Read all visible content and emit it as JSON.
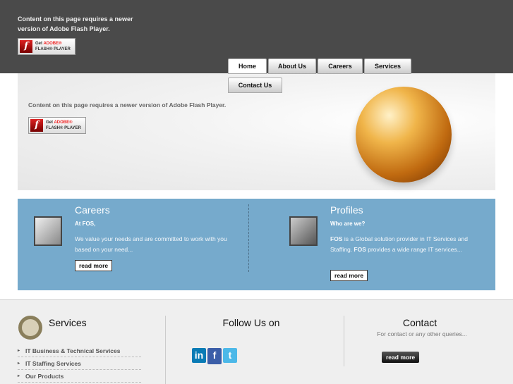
{
  "flash_notice": {
    "top_text": "Content on this page requires a newer version of Adobe Flash Player.",
    "hero_text": "Content on this page requires a newer version of Adobe Flash Player.",
    "button": {
      "get": "Get",
      "adobe": "ADOBE®",
      "player": "FLASH® PLAYER"
    }
  },
  "nav": {
    "items": [
      {
        "label": "Home"
      },
      {
        "label": "About Us"
      },
      {
        "label": "Careers"
      },
      {
        "label": "Services"
      },
      {
        "label": "Contact Us"
      }
    ]
  },
  "panel": {
    "careers": {
      "title": "Careers",
      "subtitle": "At FOS,",
      "text": "We value your needs and are committed to work with you based on your need...",
      "button": "read more"
    },
    "profiles": {
      "title": "Profiles",
      "subtitle": "Who are we?",
      "text_bold1": "FOS",
      "text1": " is a Global solution provider in IT Services and Staffing. ",
      "text_bold2": "FOS",
      "text2": " provides a wide range IT services...",
      "button": "read more"
    }
  },
  "footer": {
    "services": {
      "title": "Services",
      "items": [
        "IT Business & Technical Services",
        "IT Staffing Services",
        "Our Products"
      ]
    },
    "follow": {
      "title": "Follow Us on",
      "icons": [
        "linkedin-icon",
        "facebook-icon",
        "twitter-icon"
      ]
    },
    "contact": {
      "title": "Contact",
      "text": "For contact or any other queries...",
      "button": "read more"
    }
  },
  "colors": {
    "header": "#4a4a4a",
    "panel": "#76aacc",
    "footer": "#efefef"
  }
}
